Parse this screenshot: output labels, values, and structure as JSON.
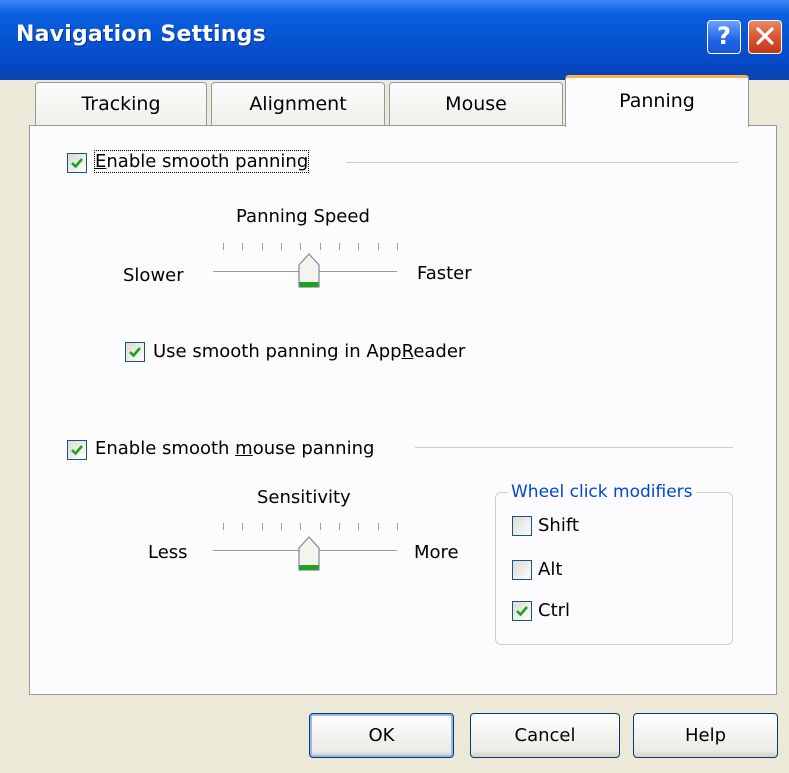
{
  "window": {
    "title": "Navigation Settings",
    "help_label": "?",
    "close_label": "X"
  },
  "tabs": [
    {
      "label": "Tracking",
      "active": false
    },
    {
      "label": "Alignment",
      "active": false
    },
    {
      "label": "Mouse",
      "active": false
    },
    {
      "label": "Panning",
      "active": true
    }
  ],
  "panning": {
    "smooth_panning": {
      "label_prefix": "",
      "label_underlined": "E",
      "label_suffix": "nable smooth panning",
      "checked": true
    },
    "speed": {
      "title": "Panning Speed",
      "min_label": "Slower",
      "max_label": "Faster",
      "tick_count": 10,
      "value_fraction": 0.5
    },
    "appreader": {
      "label_prefix": "Use smooth panning in App",
      "label_underlined": "R",
      "label_suffix": "eader",
      "checked": true
    },
    "mouse_panning": {
      "label_prefix": "Enable smooth ",
      "label_underlined": "m",
      "label_suffix": "ouse panning",
      "checked": true
    },
    "sensitivity": {
      "title": "Sensitivity",
      "min_label": "Less",
      "max_label": "More",
      "tick_count": 10,
      "value_fraction": 0.5
    },
    "wheel_modifiers": {
      "title": "Wheel click modifiers",
      "options": [
        {
          "label": "Shift",
          "checked": false
        },
        {
          "label": "Alt",
          "checked": false
        },
        {
          "label": "Ctrl",
          "checked": true
        }
      ]
    }
  },
  "buttons": {
    "ok": "OK",
    "cancel": "Cancel",
    "help": "Help"
  },
  "colors": {
    "title_bar": "#0654d3",
    "check": "#21a121",
    "group_title": "#0046d5",
    "active_tab_accent": "#f7b54a"
  }
}
